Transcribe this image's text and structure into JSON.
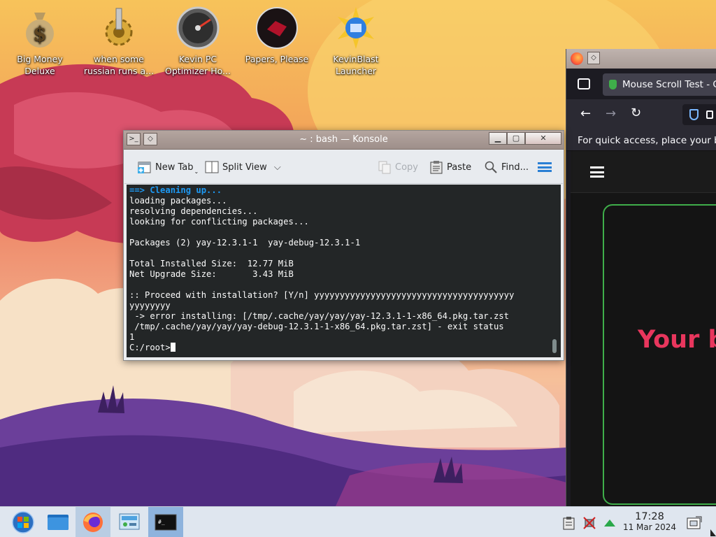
{
  "desktop": {
    "icons": [
      {
        "label": "Big Money\nDeluxe",
        "line1": "Big Money",
        "line2": "Deluxe",
        "icon": "money-bag-icon"
      },
      {
        "label": "when some russian runs a...",
        "line1": "when some",
        "line2": "russian runs a...",
        "icon": "gear-icon"
      },
      {
        "label": "Kevin PC Optimizer Ho...",
        "line1": "Kevin PC",
        "line2": "Optimizer Ho...",
        "icon": "speedometer-icon"
      },
      {
        "label": "Papers, Please",
        "line1": "Papers, Please",
        "line2": "",
        "icon": "papers-please-icon"
      },
      {
        "label": "KevinBlast Launcher",
        "line1": "KevinBlast",
        "line2": "Launcher",
        "icon": "kevinblast-icon"
      }
    ]
  },
  "konsole": {
    "title": "~ : bash — Konsole",
    "toolbar": {
      "new_tab": "New Tab",
      "split_view": "Split View",
      "copy": "Copy",
      "paste": "Paste",
      "find": "Find..."
    },
    "terminal": {
      "highlight_line": "==> Cleaning up...",
      "lines": [
        "loading packages...",
        "resolving dependencies...",
        "looking for conflicting packages...",
        "",
        "Packages (2) yay-12.3.1-1  yay-debug-12.3.1-1",
        "",
        "Total Installed Size:  12.77 MiB",
        "Net Upgrade Size:       3.43 MiB",
        "",
        ":: Proceed with installation? [Y/n] yyyyyyyyyyyyyyyyyyyyyyyyyyyyyyyyyyyyyyy",
        "yyyyyyyy",
        " -> error installing: [/tmp/.cache/yay/yay/yay-12.3.1-1-x86_64.pkg.tar.zst",
        " /tmp/.cache/yay/yay/yay-debug-12.3.1-1-x86_64.pkg.tar.zst] - exit status",
        "1"
      ],
      "prompt": "C:/root>"
    }
  },
  "firefox": {
    "tab_title": "Mouse Scroll Test - C",
    "bookmarks_hint": "For quick access, place your bo",
    "page_heading": "Your b"
  },
  "taskbar": {
    "clock_time": "17:28",
    "clock_date": "11 Mar 2024"
  },
  "colors": {
    "accent": "#1d99f3",
    "terminal_bg": "#232627",
    "card_border": "#3fae4a",
    "heading_red": "#e8365d"
  }
}
